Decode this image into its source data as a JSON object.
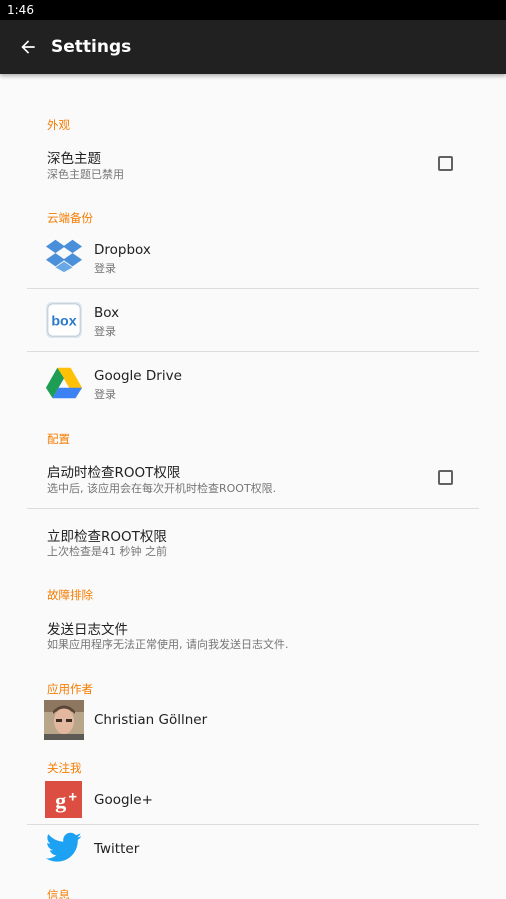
{
  "status_bar": {
    "time": "1:46"
  },
  "app_bar": {
    "title": "Settings",
    "back_icon": "arrow-back-icon"
  },
  "sections": {
    "appearance": "外观",
    "cloud_backup": "云端备份",
    "config": "配置",
    "troubleshooting": "故障排除",
    "app_author": "应用作者",
    "follow_me": "关注我",
    "info": "信息"
  },
  "dark_theme": {
    "title": "深色主题",
    "summary": "深色主题已禁用",
    "checked": false
  },
  "cloud": [
    {
      "title": "Dropbox",
      "summary": "登录",
      "icon": "dropbox-icon"
    },
    {
      "title": "Box",
      "summary": "登录",
      "icon": "box-icon"
    },
    {
      "title": "Google Drive",
      "summary": "登录",
      "icon": "google-drive-icon"
    }
  ],
  "root_on_boot": {
    "title": "启动时检查ROOT权限",
    "summary": "选中后, 该应用会在每次开机时检查ROOT权限.",
    "checked": false
  },
  "root_now": {
    "title": "立即检查ROOT权限",
    "summary": "上次检查是41 秒钟 之前"
  },
  "send_log": {
    "title": "发送日志文件",
    "summary": "如果应用程序无法正常使用, 请向我发送日志文件."
  },
  "author": {
    "name": "Christian Göllner",
    "icon": "avatar"
  },
  "social": [
    {
      "title": "Google+",
      "icon": "google-plus-icon",
      "color": "#dc4e41"
    },
    {
      "title": "Twitter",
      "icon": "twitter-icon",
      "color": "#1da1f2"
    }
  ],
  "colors": {
    "accent": "#f57c00",
    "appbar": "#212121",
    "background": "#fafafa"
  }
}
